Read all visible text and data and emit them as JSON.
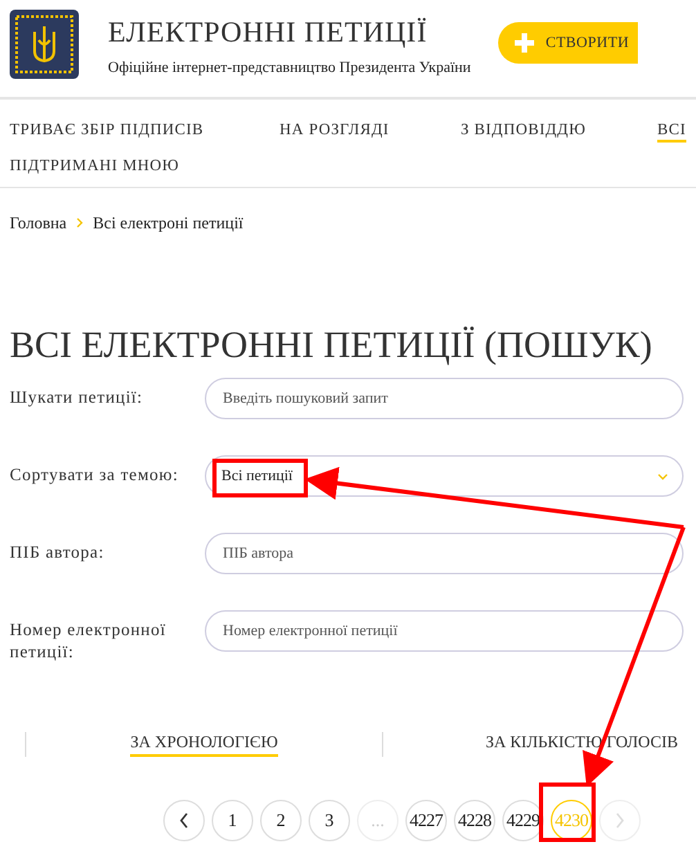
{
  "header": {
    "title": "ЕЛЕКТРОННІ ПЕТИЦІЇ",
    "subtitle": "Офіційне інтернет-представництво Президента України",
    "create_button": "СТВОРИТИ"
  },
  "nav": [
    {
      "label": "ТРИВАЄ ЗБІР ПІДПИСІВ",
      "selected": false
    },
    {
      "label": "НА РОЗГЛЯДІ",
      "selected": false
    },
    {
      "label": "З ВІДПОВІДДЮ",
      "selected": false
    },
    {
      "label": "ВСІ",
      "selected": true
    },
    {
      "label": "ПІДТРИМАНІ МНОЮ",
      "selected": false
    }
  ],
  "breadcrumb": [
    "Головна",
    "Всі електроні петиції"
  ],
  "heading": "ВСІ ЕЛЕКТРОННІ ПЕТИЦІЇ (ПОШУК)",
  "form": [
    {
      "kind": "text",
      "label": "Шукати петиції:",
      "placeholder": "Введіть пошуковий запит"
    },
    {
      "kind": "select",
      "label": "Сортувати за темою:",
      "value": "Всі петиції"
    },
    {
      "kind": "text",
      "label": "ПІБ автора:",
      "placeholder": "ПІБ автора"
    },
    {
      "kind": "text",
      "label": "Номер електронної петиції:",
      "placeholder": "Номер електронної петиції"
    }
  ],
  "sort_tabs": [
    {
      "label": "ЗА ХРОНОЛОГІЄЮ",
      "selected": true
    },
    {
      "label": "ЗА КІЛЬКІСТЮ ГОЛОСІВ",
      "selected": false
    }
  ],
  "pagination": [
    {
      "kind": "prev",
      "disabled": false
    },
    {
      "kind": "page",
      "label": "1",
      "selected": false
    },
    {
      "kind": "page",
      "label": "2",
      "selected": false
    },
    {
      "kind": "page",
      "label": "3",
      "selected": false
    },
    {
      "kind": "gap",
      "label": "...",
      "disabled": true
    },
    {
      "kind": "page",
      "label": "4227",
      "selected": false
    },
    {
      "kind": "page",
      "label": "4228",
      "selected": false
    },
    {
      "kind": "page",
      "label": "4229",
      "selected": false
    },
    {
      "kind": "page",
      "label": "4230",
      "selected": true
    },
    {
      "kind": "next",
      "disabled": true
    }
  ]
}
